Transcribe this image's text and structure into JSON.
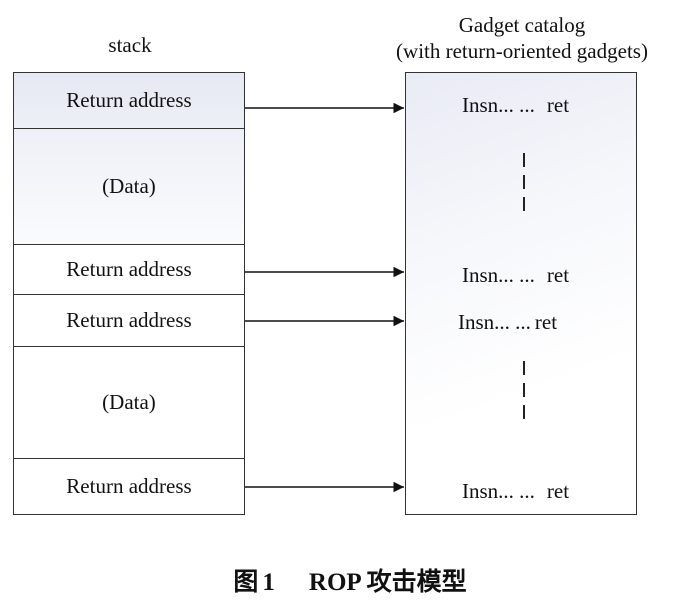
{
  "headers": {
    "stack": "stack",
    "gadget_line1": "Gadget catalog",
    "gadget_line2": "(with return-oriented gadgets)"
  },
  "stack": {
    "cells": [
      {
        "label": "Return address",
        "kind": "return"
      },
      {
        "label": "(Data)",
        "kind": "data"
      },
      {
        "label": "Return address",
        "kind": "return"
      },
      {
        "label": "Return address",
        "kind": "return"
      },
      {
        "label": "(Data)",
        "kind": "data"
      },
      {
        "label": "Return address",
        "kind": "return"
      }
    ]
  },
  "gadgets": {
    "entries": [
      {
        "insn": "Insn... ...",
        "ret": "ret"
      },
      {
        "insn": "Insn... ...",
        "ret": "ret"
      },
      {
        "insn": "Insn... ...",
        "ret": "ret"
      },
      {
        "insn": "Insn... ...",
        "ret": "ret"
      }
    ]
  },
  "caption": {
    "figure": "图",
    "number": "1",
    "title": "ROP 攻击模型"
  },
  "colors": {
    "stack_top_fill": "#e9ebf5",
    "line": "#333333"
  }
}
